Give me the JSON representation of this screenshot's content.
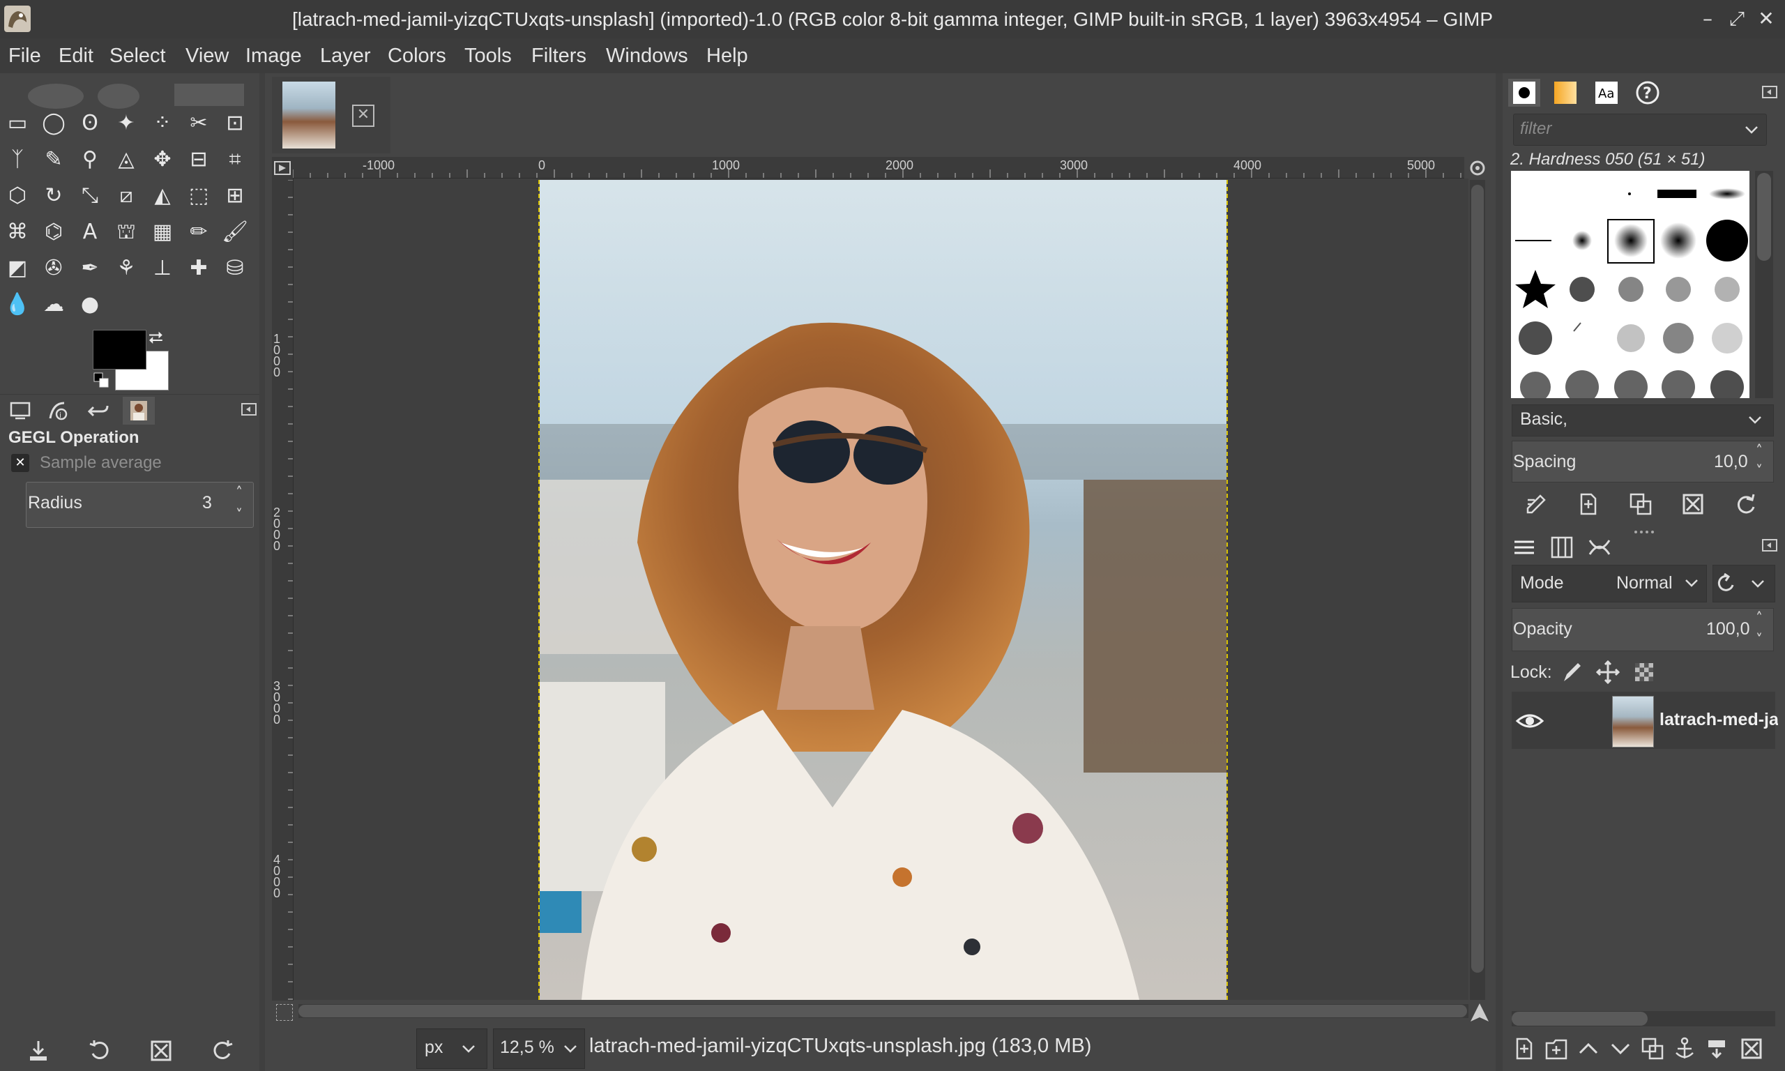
{
  "window": {
    "title": "[latrach-med-jamil-yizqCTUxqts-unsplash] (imported)-1.0 (RGB color 8-bit gamma integer, GIMP built-in sRGB, 1 layer) 3963x4954 – GIMP",
    "controls": [
      "–",
      "⤢",
      "✕"
    ]
  },
  "menu": [
    "File",
    "Edit",
    "Select",
    "View",
    "Image",
    "Layer",
    "Colors",
    "Tools",
    "Filters",
    "Windows",
    "Help"
  ],
  "tool_options": {
    "title": "GEGL Operation",
    "sample_label": "Sample average",
    "radius_label": "Radius",
    "radius_value": "3"
  },
  "rulers": {
    "horizontal": [
      "-1000",
      "0",
      "1000",
      "2000",
      "3000",
      "4000",
      "5000"
    ],
    "vertical": [
      "1000",
      "2000",
      "3000",
      "4000"
    ]
  },
  "status": {
    "unit": "px",
    "zoom": "12,5 %",
    "file_info": "latrach-med-jamil-yizqCTUxqts-unsplash.jpg (183,0 MB)"
  },
  "brushes": {
    "filter_placeholder": "filter",
    "selected_brush": "2. Hardness 050 (51 × 51)",
    "preset": "Basic,",
    "spacing_label": "Spacing",
    "spacing_value": "10,0"
  },
  "layers": {
    "mode_label": "Mode",
    "mode_value": "Normal",
    "opacity_label": "Opacity",
    "opacity_value": "100,0",
    "lock_label": "Lock:",
    "items": [
      {
        "name": "latrach-med-jamil-yizqCTUxqts-unsplash",
        "visible": true
      }
    ]
  },
  "colors": {
    "foreground": "#000000",
    "background": "#ffffff",
    "canvas_border": "#d8c100"
  }
}
